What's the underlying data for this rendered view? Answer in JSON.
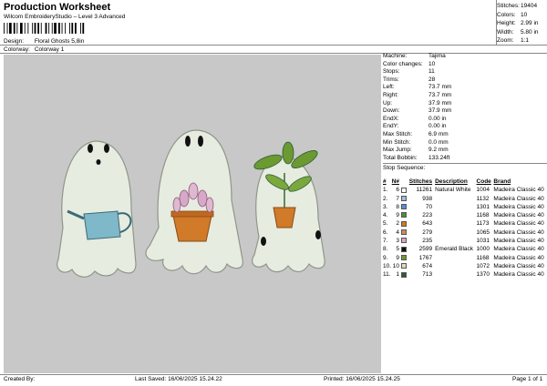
{
  "header": {
    "title": "Production Worksheet",
    "subtitle": "Wilcom EmbroideryStudio – Level 3 Advanced",
    "design_label": "Design:",
    "design_value": "Floral Ghosts 5,8in",
    "colorway_label": "Colorway:",
    "colorway_value": "Colorway 1"
  },
  "stats": [
    {
      "label": "Stitches:",
      "value": "19404"
    },
    {
      "label": "Colors:",
      "value": "10"
    },
    {
      "label": "Height:",
      "value": "2.99 in"
    },
    {
      "label": "Width:",
      "value": "5.80 in"
    },
    {
      "label": "Zoom:",
      "value": "1:1"
    }
  ],
  "machine_info": [
    {
      "label": "Machine:",
      "value": "Tajima"
    },
    {
      "label": "Color changes:",
      "value": "10"
    },
    {
      "label": "Stops:",
      "value": "11"
    },
    {
      "label": "Trims:",
      "value": "28"
    },
    {
      "label": "Left:",
      "value": "73.7 mm"
    },
    {
      "label": "Right:",
      "value": "73.7 mm"
    },
    {
      "label": "Up:",
      "value": "37.9 mm"
    },
    {
      "label": "Down:",
      "value": "37.9 mm"
    },
    {
      "label": "EndX:",
      "value": "0.00 in"
    },
    {
      "label": "EndY:",
      "value": "0.00 in"
    },
    {
      "label": "Max Stitch:",
      "value": "6.9 mm"
    },
    {
      "label": "Min Stitch:",
      "value": "0.0 mm"
    },
    {
      "label": "Max Jump:",
      "value": "9.2 mm"
    },
    {
      "label": "Total Bobbin:",
      "value": "133.24ft"
    }
  ],
  "stop_sequence": {
    "title": "Stop Sequence:",
    "headers": [
      "#",
      "N#",
      "",
      "Stitches",
      "Description",
      "Code",
      "Brand"
    ],
    "rows": [
      {
        "num": "1.",
        "n": "6",
        "color": "#ffffff",
        "stitches": "11261",
        "desc": "Natural White",
        "code": "1004",
        "brand": "Madeira Classic 40"
      },
      {
        "num": "2.",
        "n": "7",
        "color": "#a8b8d8",
        "stitches": "938",
        "desc": "",
        "code": "1132",
        "brand": "Madeira Classic 40"
      },
      {
        "num": "3.",
        "n": "8",
        "color": "#5a8fd0",
        "stitches": "70",
        "desc": "",
        "code": "1301",
        "brand": "Madeira Classic 40"
      },
      {
        "num": "4.",
        "n": "9",
        "color": "#4a8f3c",
        "stitches": "223",
        "desc": "",
        "code": "1168",
        "brand": "Madeira Classic 40"
      },
      {
        "num": "5.",
        "n": "2",
        "color": "#d87820",
        "stitches": "643",
        "desc": "",
        "code": "1173",
        "brand": "Madeira Classic 40"
      },
      {
        "num": "6.",
        "n": "4",
        "color": "#c89060",
        "stitches": "279",
        "desc": "",
        "code": "1065",
        "brand": "Madeira Classic 40"
      },
      {
        "num": "7.",
        "n": "3",
        "color": "#d8a8c8",
        "stitches": "235",
        "desc": "",
        "code": "1031",
        "brand": "Madeira Classic 40"
      },
      {
        "num": "8.",
        "n": "5",
        "color": "#111111",
        "stitches": "2599",
        "desc": "Emerald Black",
        "code": "1000",
        "brand": "Madeira Classic 40"
      },
      {
        "num": "9.",
        "n": "9",
        "color": "#6a9a30",
        "stitches": "1767",
        "desc": "",
        "code": "1168",
        "brand": "Madeira Classic 40"
      },
      {
        "num": "10.",
        "n": "10",
        "color": "#d8dcc0",
        "stitches": "674",
        "desc": "",
        "code": "1072",
        "brand": "Madeira Classic 40"
      },
      {
        "num": "11.",
        "n": "1",
        "color": "#2f5a3a",
        "stitches": "713",
        "desc": "",
        "code": "1370",
        "brand": "Madeira Classic 40"
      }
    ]
  },
  "footer": {
    "created_by": "Created By:",
    "last_saved": "Last Saved: 16/06/2025 15.24.22",
    "printed": "Printed: 16/06/2025 15.24.25",
    "page": "Page 1 of 1"
  },
  "colors": {
    "canvas_bg": "#c8c8c8",
    "ghost_fill": "#e6ece0",
    "ghost_stroke": "#8f968a"
  }
}
